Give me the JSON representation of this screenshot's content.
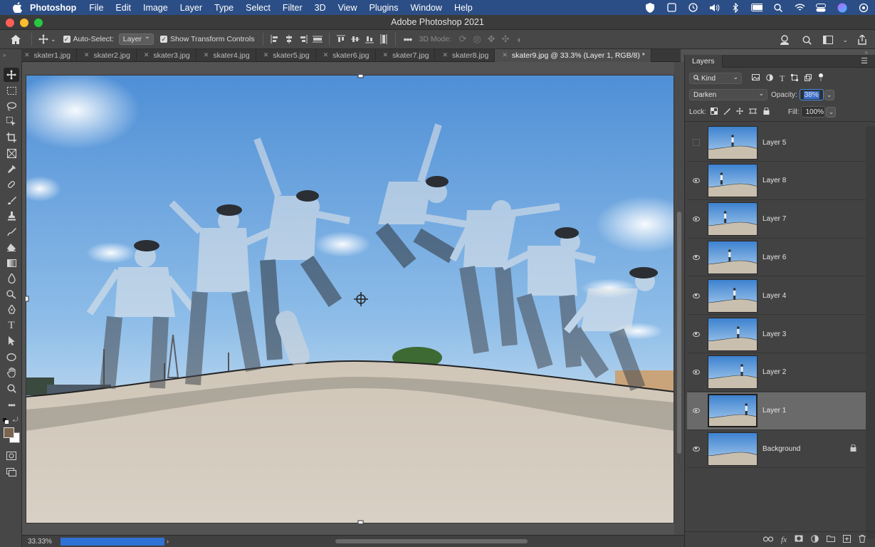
{
  "menubar": {
    "app_name": "Photoshop",
    "items": [
      "File",
      "Edit",
      "Image",
      "Layer",
      "Type",
      "Select",
      "Filter",
      "3D",
      "View",
      "Plugins",
      "Window",
      "Help"
    ]
  },
  "window": {
    "title": "Adobe Photoshop 2021"
  },
  "options": {
    "auto_select_label": "Auto-Select:",
    "auto_select_target": "Layer",
    "show_transform_label": "Show Transform Controls",
    "mode_3d_label": "3D Mode:"
  },
  "tabs": [
    {
      "label": "skater1.jpg"
    },
    {
      "label": "skater2.jpg"
    },
    {
      "label": "skater3.jpg"
    },
    {
      "label": "skater4.jpg"
    },
    {
      "label": "skater5.jpg"
    },
    {
      "label": "skater6.jpg"
    },
    {
      "label": "skater7.jpg"
    },
    {
      "label": "skater8.jpg"
    },
    {
      "label": "skater9.jpg @ 33.3% (Layer 1, RGB/8) *"
    }
  ],
  "status": {
    "zoom": "33.33%"
  },
  "layers_panel": {
    "tab_label": "Layers",
    "filter_kind": "Kind",
    "blend_mode": "Darken",
    "opacity_label": "Opacity:",
    "opacity_value": "38%",
    "lock_label": "Lock:",
    "fill_label": "Fill:",
    "fill_value": "100%",
    "layers": [
      {
        "name": "Layer 5",
        "visible": false,
        "skater_pos": 0.5
      },
      {
        "name": "Layer 8",
        "visible": true,
        "skater_pos": 0.2
      },
      {
        "name": "Layer 7",
        "visible": true,
        "skater_pos": 0.3
      },
      {
        "name": "Layer 6",
        "visible": true,
        "skater_pos": 0.42
      },
      {
        "name": "Layer 4",
        "visible": true,
        "skater_pos": 0.55
      },
      {
        "name": "Layer 3",
        "visible": true,
        "skater_pos": 0.65
      },
      {
        "name": "Layer 2",
        "visible": true,
        "skater_pos": 0.75
      },
      {
        "name": "Layer 1",
        "visible": true,
        "skater_pos": 0.85,
        "selected": true
      },
      {
        "name": "Background",
        "visible": true,
        "locked": true
      }
    ]
  },
  "colors": {
    "menubar_bg": "#2c4e86",
    "selection_blue": "#4a8fe8",
    "progress_blue": "#2f72d6"
  }
}
